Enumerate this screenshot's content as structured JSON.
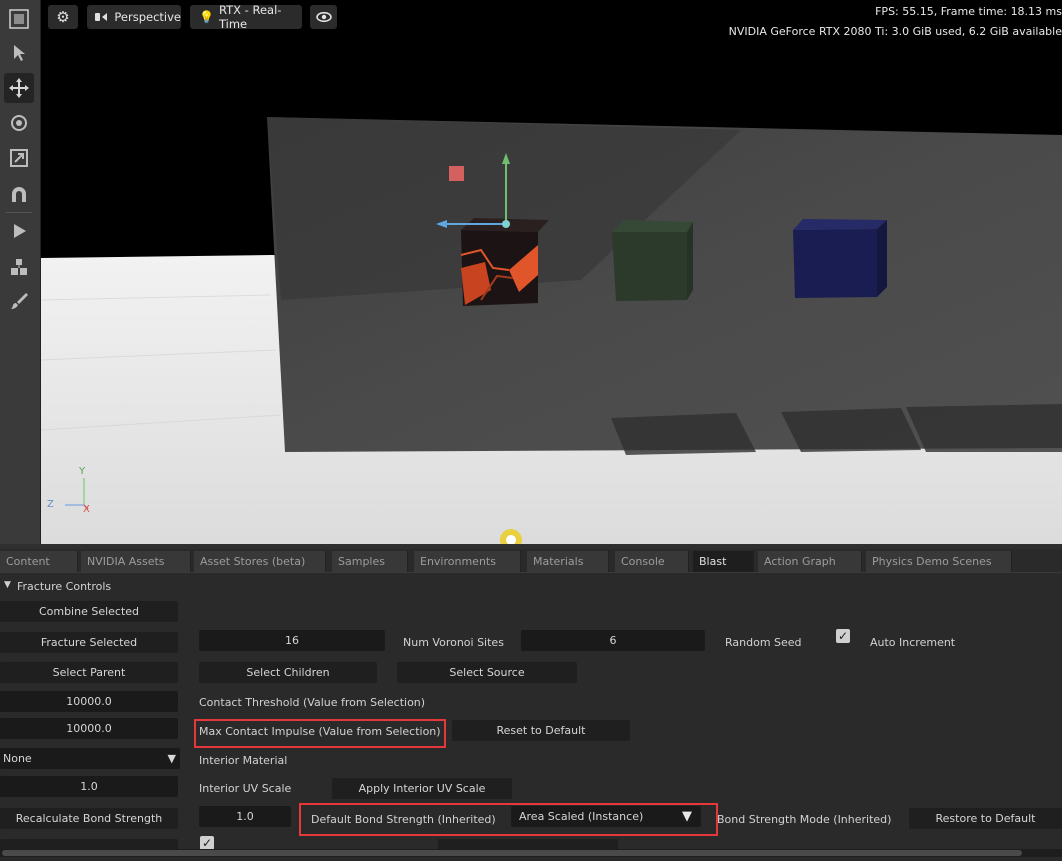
{
  "viewport": {
    "camera_label": "Perspective",
    "render_label": "RTX - Real-Time",
    "fps_text": "FPS: 55.15, Frame time: 18.13 ms",
    "gpu_text": "NVIDIA GeForce RTX 2080 Ti: 3.0 GiB used,  6.2 GiB available",
    "axis_y": "Y",
    "axis_z": "Z",
    "axis_x": "X"
  },
  "tabs": [
    {
      "label": "Content"
    },
    {
      "label": "NVIDIA Assets"
    },
    {
      "label": "Asset Stores (beta)"
    },
    {
      "label": "Samples"
    },
    {
      "label": "Environments"
    },
    {
      "label": "Materials"
    },
    {
      "label": "Console"
    },
    {
      "label": "Blast",
      "active": true
    },
    {
      "label": "Action Graph"
    },
    {
      "label": "Physics Demo Scenes"
    }
  ],
  "panel": {
    "section_title": "Fracture Controls",
    "combine_selected": "Combine Selected",
    "fracture_selected": "Fracture Selected",
    "num_voronoi_value": "16",
    "num_voronoi_label": "Num Voronoi Sites",
    "random_seed_value": "6",
    "random_seed_label": "Random Seed",
    "auto_increment_label": "Auto Increment",
    "auto_increment_checked": true,
    "select_parent": "Select Parent",
    "select_children": "Select Children",
    "select_source": "Select Source",
    "contact_threshold_value": "10000.0",
    "contact_threshold_label": "Contact Threshold (Value from Selection)",
    "max_contact_value": "10000.0",
    "max_contact_label": "Max Contact Impulse (Value from Selection)",
    "reset_to_default": "Reset to Default",
    "interior_material_value": "None",
    "interior_material_label": "Interior Material",
    "interior_uv_value": "1.0",
    "interior_uv_label": "Interior UV Scale",
    "apply_interior_uv": "Apply Interior UV Scale",
    "recalc_bond": "Recalculate Bond Strength",
    "bond_strength_value": "1.0",
    "default_bond_label": "Default Bond Strength (Inherited)",
    "bond_mode_value": "Area Scaled (Instance)",
    "bond_mode_label": "Bond Strength Mode (Inherited)",
    "restore_default": "Restore to Default"
  },
  "colors": {
    "highlight_red": "#e53838",
    "cube_orange": "#e0552a",
    "cube_green": "#2c3a2c",
    "cube_blue": "#1a1d52"
  }
}
